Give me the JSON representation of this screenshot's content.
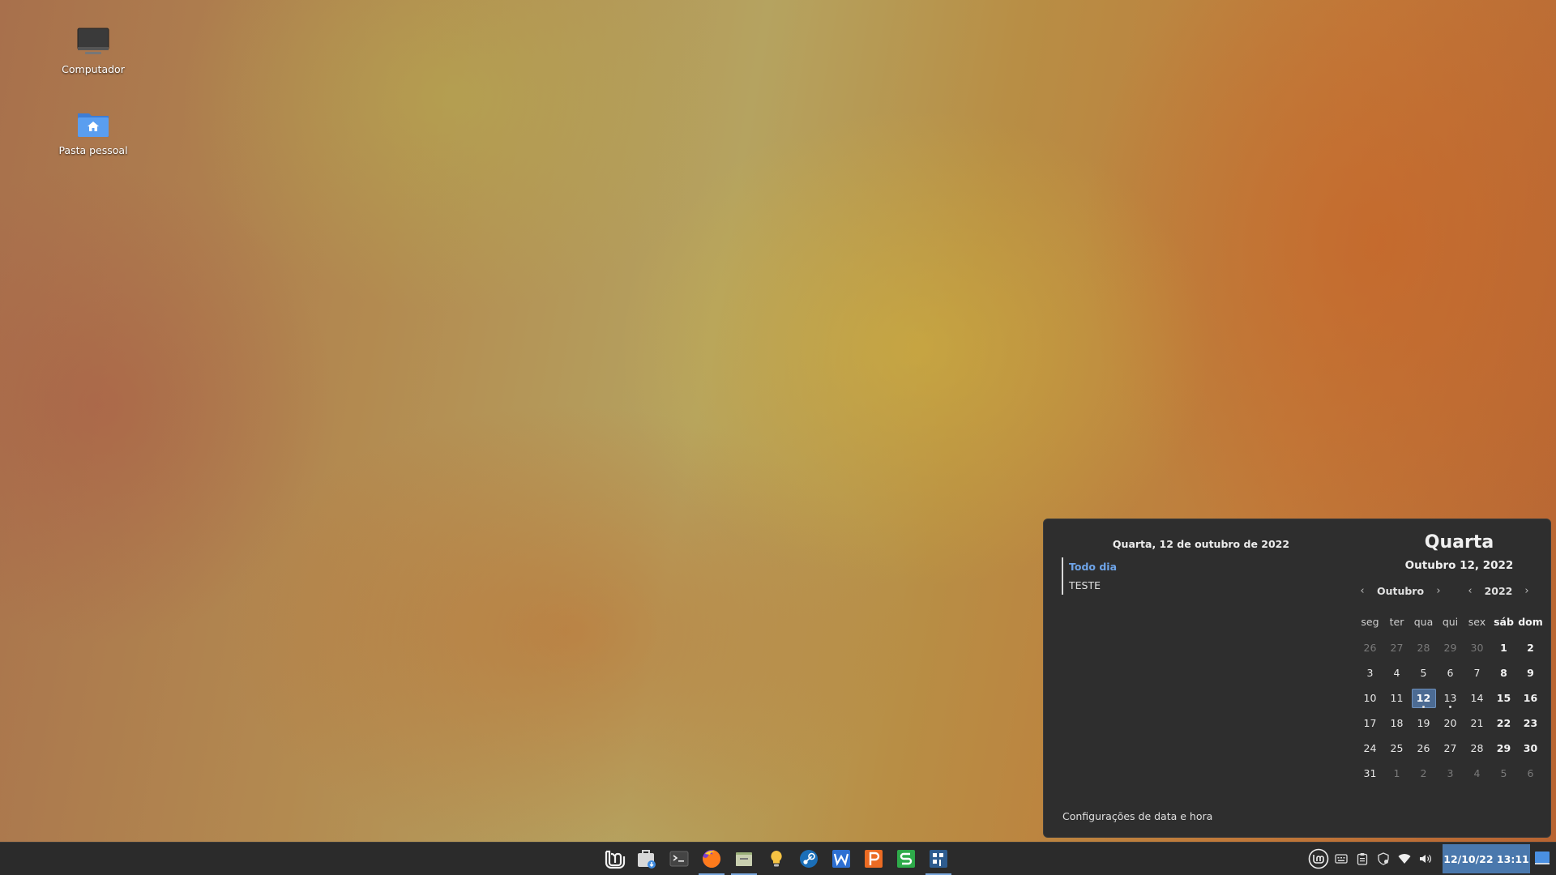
{
  "desktop": {
    "icons": [
      {
        "label": "Computador",
        "icon": "computer-icon"
      },
      {
        "label": "Pasta pessoal",
        "icon": "home-folder-icon"
      }
    ]
  },
  "calendar_popup": {
    "events_date": "Quarta, 12 de outubro de 2022",
    "events": [
      {
        "when": "Todo dia",
        "what": "TESTE"
      }
    ],
    "settings_link": "Configurações de data e hora",
    "day_title": "Quarta",
    "date_sub": "Outubro 12, 2022",
    "month": "Outubro",
    "year": "2022",
    "weekdays": [
      "seg",
      "ter",
      "qua",
      "qui",
      "sex",
      "sáb",
      "dom"
    ],
    "weeks": [
      [
        "26",
        "27",
        "28",
        "29",
        "30",
        "1",
        "2"
      ],
      [
        "3",
        "4",
        "5",
        "6",
        "7",
        "8",
        "9"
      ],
      [
        "10",
        "11",
        "12",
        "13",
        "14",
        "15",
        "16"
      ],
      [
        "17",
        "18",
        "19",
        "20",
        "21",
        "22",
        "23"
      ],
      [
        "24",
        "25",
        "26",
        "27",
        "28",
        "29",
        "30"
      ],
      [
        "31",
        "1",
        "2",
        "3",
        "4",
        "5",
        "6"
      ]
    ],
    "today": "12",
    "event_days": [
      "12",
      "13"
    ]
  },
  "taskbar": {
    "apps": [
      {
        "name": "mint-menu",
        "icon": "mint-logo-icon"
      },
      {
        "name": "software-manager",
        "icon": "software-manager-icon"
      },
      {
        "name": "terminal",
        "icon": "terminal-icon"
      },
      {
        "name": "firefox",
        "icon": "firefox-icon",
        "active": true
      },
      {
        "name": "files",
        "icon": "file-manager-icon",
        "active": true
      },
      {
        "name": "hypnotix",
        "icon": "lightbulb-icon"
      },
      {
        "name": "steam",
        "icon": "steam-icon"
      },
      {
        "name": "writer",
        "icon": "writer-icon"
      },
      {
        "name": "presentation",
        "icon": "presentation-icon"
      },
      {
        "name": "spreadsheet",
        "icon": "spreadsheet-icon"
      },
      {
        "name": "workspace",
        "icon": "grid-icon",
        "active": true
      }
    ],
    "clock": "12/10/22 13:11",
    "accent": "#4a78ad"
  }
}
